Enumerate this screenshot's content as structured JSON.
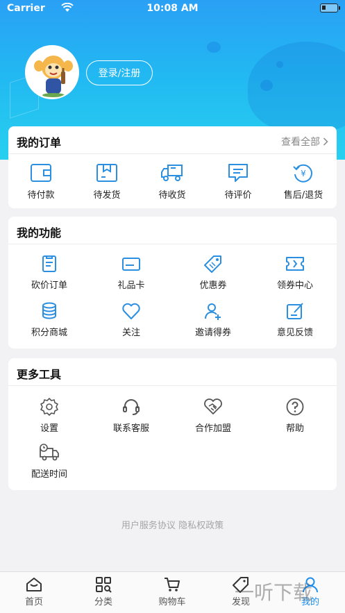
{
  "status_bar": {
    "carrier": "Carrier",
    "time": "10:08 AM"
  },
  "profile": {
    "login_label": "登录/注册"
  },
  "orders": {
    "title": "我的订单",
    "view_all": "查看全部",
    "items": [
      {
        "label": "待付款",
        "icon": "wallet-icon"
      },
      {
        "label": "待发货",
        "icon": "package-icon"
      },
      {
        "label": "待收货",
        "icon": "delivery-truck-icon"
      },
      {
        "label": "待评价",
        "icon": "comment-icon"
      },
      {
        "label": "售后/退货",
        "icon": "refund-icon"
      }
    ]
  },
  "features": {
    "title": "我的功能",
    "items": [
      {
        "label": "砍价订单",
        "icon": "clipboard-icon"
      },
      {
        "label": "礼品卡",
        "icon": "card-icon"
      },
      {
        "label": "优惠券",
        "icon": "tag-icon"
      },
      {
        "label": "领券中心",
        "icon": "ticket-icon"
      },
      {
        "label": "积分商城",
        "icon": "coins-icon"
      },
      {
        "label": "关注",
        "icon": "heart-icon"
      },
      {
        "label": "邀请得券",
        "icon": "add-user-icon"
      },
      {
        "label": "意见反馈",
        "icon": "feedback-icon"
      }
    ]
  },
  "tools": {
    "title": "更多工具",
    "items": [
      {
        "label": "设置",
        "icon": "gear-icon"
      },
      {
        "label": "联系客服",
        "icon": "headset-icon"
      },
      {
        "label": "合作加盟",
        "icon": "handshake-icon"
      },
      {
        "label": "帮助",
        "icon": "help-icon"
      },
      {
        "label": "配送时间",
        "icon": "delivery-time-icon"
      }
    ]
  },
  "footer": {
    "user_agreement": "用户服务协议",
    "privacy_policy": "隐私权政策"
  },
  "tabbar": {
    "tabs": [
      {
        "label": "首页",
        "icon": "home-icon"
      },
      {
        "label": "分类",
        "icon": "category-icon"
      },
      {
        "label": "购物车",
        "icon": "cart-icon"
      },
      {
        "label": "发现",
        "icon": "discover-icon"
      },
      {
        "label": "我的",
        "icon": "profile-icon"
      }
    ],
    "active": "我的"
  },
  "watermark": "一听下载",
  "colors": {
    "accent": "#1c8ef0",
    "header_top": "#2aa0f5",
    "header_bottom": "#27d0ef",
    "icon": "#2a8fe0"
  }
}
